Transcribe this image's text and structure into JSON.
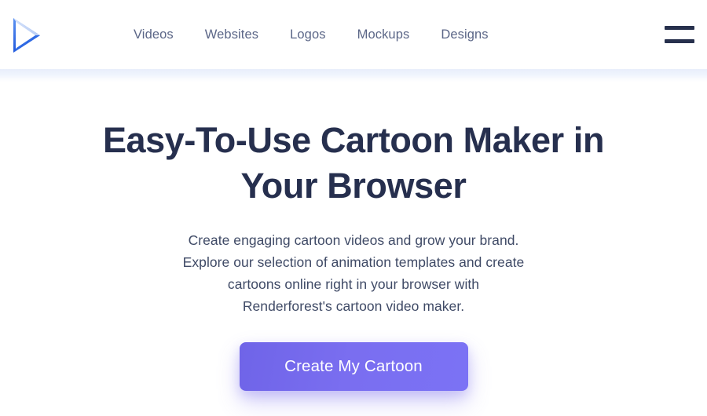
{
  "header": {
    "logo": {
      "name": "renderforest-play-logo",
      "colors": {
        "light": "#c3d4f5",
        "mid": "#4f86ef",
        "dark": "#1f5fe0"
      }
    },
    "nav_items": [
      {
        "label": "Videos"
      },
      {
        "label": "Websites"
      },
      {
        "label": "Logos"
      },
      {
        "label": "Mockups"
      },
      {
        "label": "Designs"
      }
    ],
    "menu_button": {
      "name": "hamburger-menu",
      "bar_color": "#27304d"
    }
  },
  "hero": {
    "title_lines": [
      "Easy-To-Use Cartoon Maker in",
      "Your Browser"
    ],
    "subtitle_lines": [
      "Create engaging cartoon videos and grow your brand.",
      "Explore our selection of animation templates and create",
      "cartoons online right in your browser with",
      "Renderforest's cartoon video maker."
    ],
    "cta_label": "Create My Cartoon"
  },
  "colors": {
    "page_background": "#ffffff",
    "header_background": "#ffffff",
    "header_shadow": "#e8eefb",
    "heading_text": "#262f4e",
    "body_text": "#3f4a66",
    "nav_text": "#5b6687",
    "cta_gradient_start": "#6f64e8",
    "cta_gradient_end": "#7b72f5",
    "cta_text": "#ffffff"
  }
}
